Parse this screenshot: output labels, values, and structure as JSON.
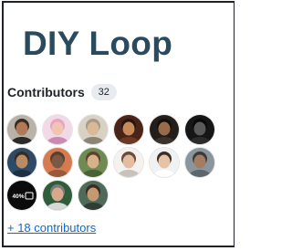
{
  "header": {
    "title": "DIY Loop"
  },
  "contributors": {
    "label": "Contributors",
    "count": "32",
    "more_link": "+ 18 contributors",
    "avatars": [
      {
        "bg": "#b8b2a8",
        "skin": "#b07a58",
        "hair": "#3a2a20",
        "shirt": "#2a2a2a"
      },
      {
        "bg": "#f2d9e6",
        "skin": "#f0c6b2",
        "hair": "#e9a3c4",
        "shirt": "#c98ab4"
      },
      {
        "bg": "#d8d2c4",
        "skin": "#d8b998",
        "hair": "#a89a86",
        "shirt": "#8c8576"
      },
      {
        "bg": "#4a2418",
        "skin": "#c68a5c",
        "hair": "#2a150e",
        "shirt": "#6b3a22"
      },
      {
        "bg": "#231e1a",
        "skin": "#9a6b48",
        "hair": "#120f0d",
        "shirt": "#3a322c"
      },
      {
        "bg": "#161616",
        "skin": "#5a5a5a",
        "hair": "#0a0a0a",
        "shirt": "#2c2c2c"
      },
      {
        "bg": "#2f4a66",
        "skin": "#b88a66",
        "hair": "#3b2a1e",
        "shirt": "#1e2f44"
      },
      {
        "bg": "#d67b4f",
        "skin": "#7a5a44",
        "hair": "#5b4030",
        "shirt": "#9a5a3a"
      },
      {
        "bg": "#6f8a52",
        "skin": "#d8b08a",
        "hair": "#5a4430",
        "shirt": "#4a6238"
      },
      {
        "bg": "#f4f1ee",
        "skin": "#e4bca0",
        "hair": "#6a4c3a",
        "shirt": "#c9c2bc"
      },
      {
        "bg": "#eff1f3",
        "skin": "#e6c2a6",
        "hair": "#3a2e26",
        "shirt": "#ffffff"
      },
      {
        "bg": "#8b959c",
        "skin": "#a67d62",
        "hair": "#3a3a3a",
        "shirt": "#5d666c"
      },
      {
        "bg": "#0b0b0b",
        "skin": "#0b0b0b",
        "hair": "#0b0b0b",
        "shirt": "#0b0b0b",
        "text": "40%"
      },
      {
        "bg": "#2e5d3a",
        "skin": "#d8a88a",
        "hair": "#7a7a7a",
        "shirt": "#d8d8d8"
      },
      {
        "bg": "#4f6a58",
        "skin": "#c69872",
        "hair": "#3a2c20",
        "shirt": "#2e3e34"
      }
    ]
  },
  "colors": {
    "title": "#2a4a5e",
    "link": "#0969da",
    "badge_bg": "#e8ebef"
  }
}
